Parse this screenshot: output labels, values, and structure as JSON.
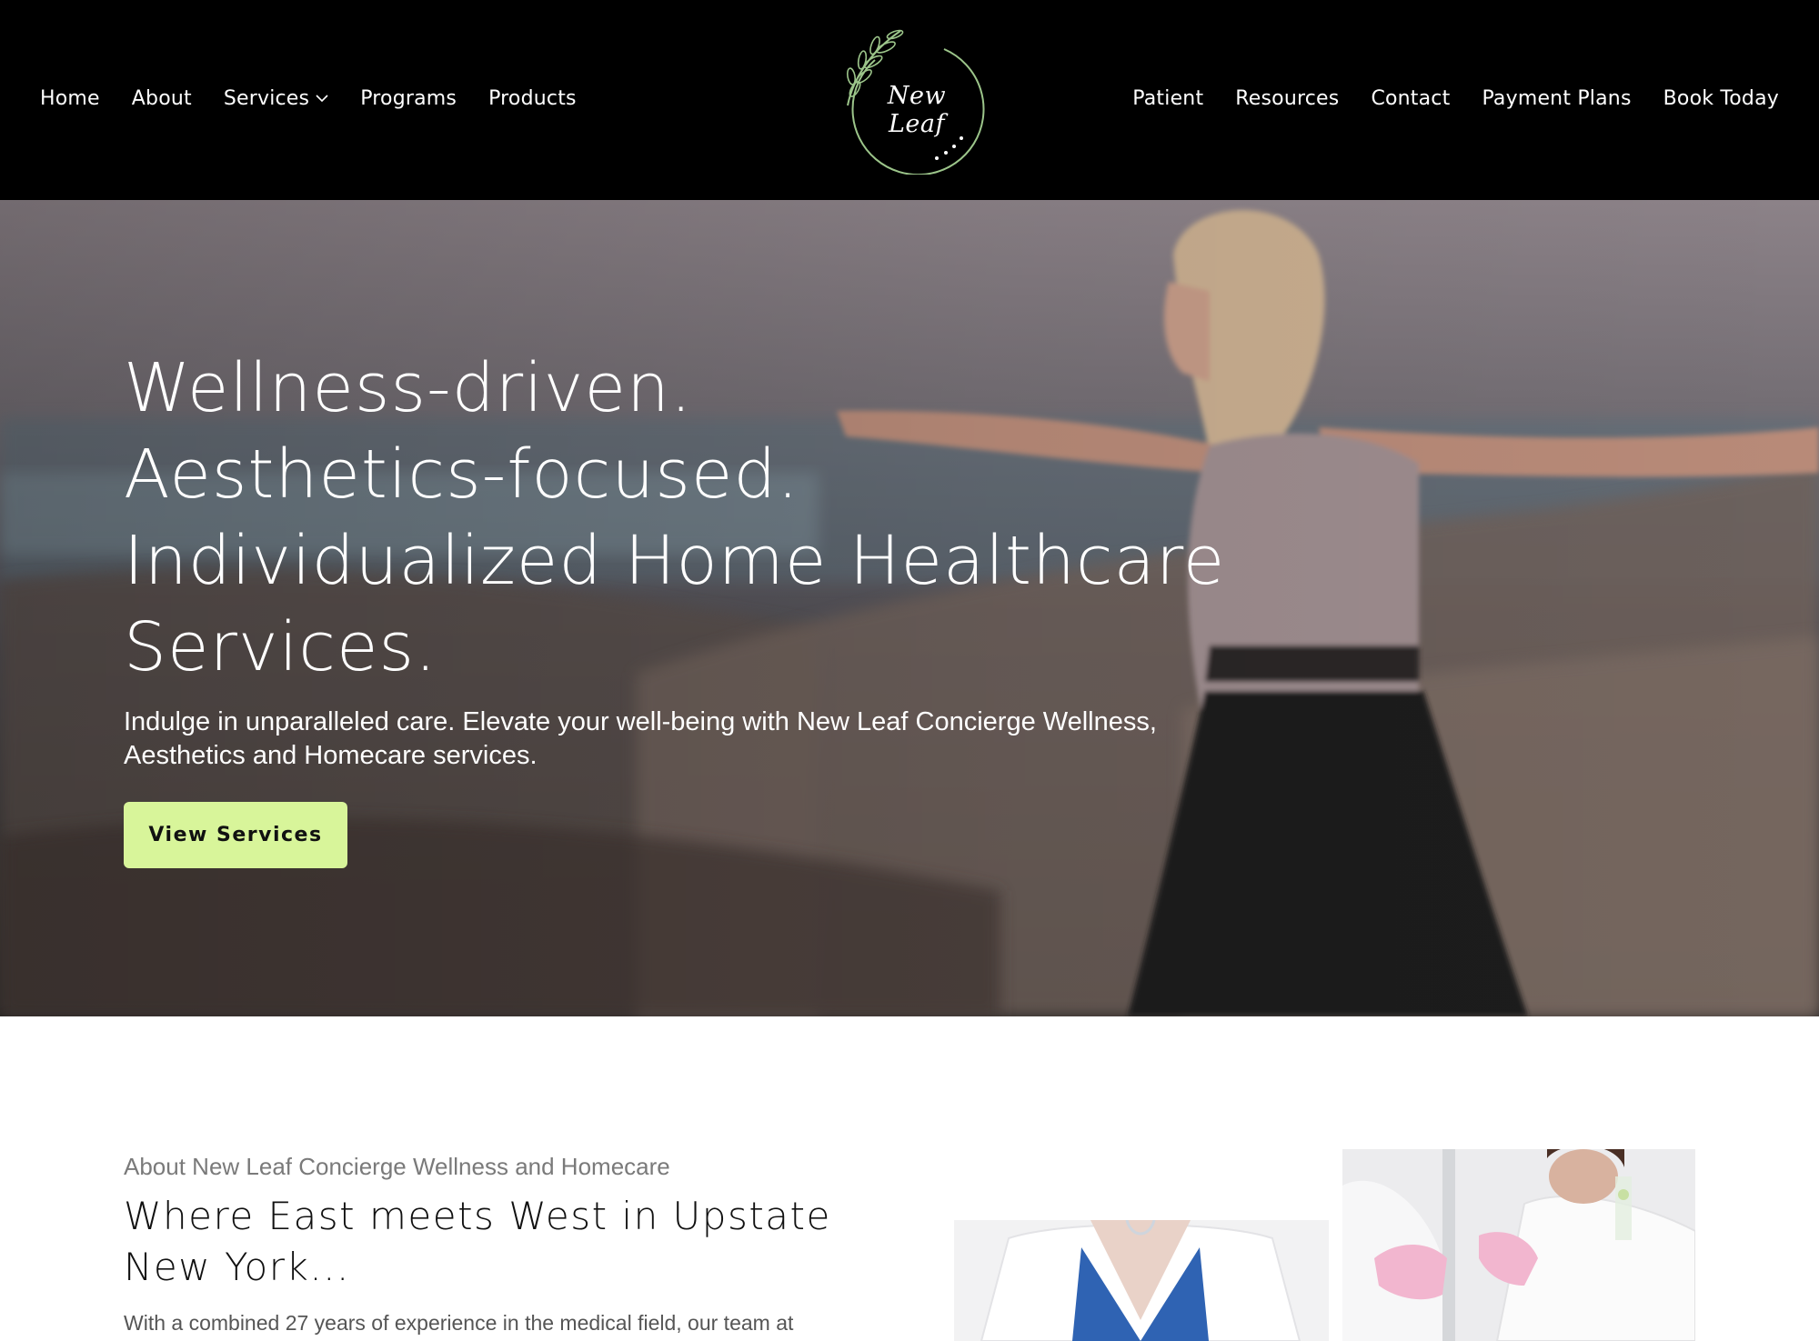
{
  "brand": {
    "logo_text": "New Leaf",
    "accent_color": "#d8f59a",
    "leaf_color": "#9cc58a"
  },
  "nav": {
    "left": [
      {
        "label": "Home"
      },
      {
        "label": "About"
      },
      {
        "label": "Services",
        "dropdown": true
      },
      {
        "label": "Programs"
      },
      {
        "label": "Products"
      }
    ],
    "right": [
      {
        "label": "Patient"
      },
      {
        "label": "Resources"
      },
      {
        "label": "Contact"
      },
      {
        "label": "Payment Plans"
      },
      {
        "label": "Book Today"
      }
    ]
  },
  "hero": {
    "headline_lines": [
      "Wellness-driven.",
      "Aesthetics-focused.",
      "Individualized Home Healthcare",
      "Services."
    ],
    "subtext": "Indulge in unparalleled care. Elevate your well-being with New Leaf Concierge Wellness, Aesthetics and Homecare services.",
    "cta_label": "View Services"
  },
  "about": {
    "eyebrow": "About New Leaf Concierge Wellness and Homecare",
    "title": "Where East meets West in Upstate New York...",
    "body": "With a combined 27 years of experience in the medical field, our team at"
  },
  "icons": {
    "services_dropdown": "chevron-down-icon",
    "logo": "leaf-wreath-logo-icon"
  }
}
